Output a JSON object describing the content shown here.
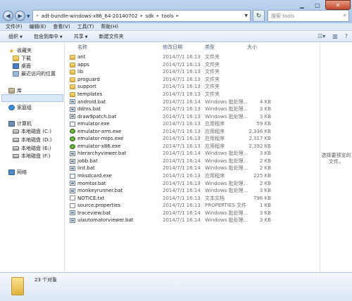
{
  "address": {
    "crumbs": [
      "adt-bundle-windows-x86_64-20140702",
      "sdk",
      "tools"
    ]
  },
  "search": {
    "placeholder": "搜索 tools"
  },
  "menubar": {
    "items": [
      "文件(F)",
      "编辑(E)",
      "查看(V)",
      "工具(T)",
      "帮助(H)"
    ]
  },
  "toolbar": {
    "organize": "组织",
    "include_in_library": "包含到库中",
    "share": "共享",
    "new_folder": "新建文件夹"
  },
  "navpane": {
    "favorites": "收藏夹",
    "downloads": "下载",
    "desktop": "桌面",
    "recent": "最近访问的位置",
    "libraries": "库",
    "homegroup": "家庭组",
    "computer": "计算机",
    "drive_c": "本地磁盘 (C:)",
    "drive_d": "本地磁盘 (D:)",
    "drive_e": "本地磁盘 (E:)",
    "drive_f": "本地磁盘 (F:)",
    "network": "网络"
  },
  "columns": {
    "name": "名称",
    "date": "修改日期",
    "type": "类型",
    "size": "大小"
  },
  "files": [
    {
      "name": "ant",
      "date": "2014/7/1 16:13",
      "type": "文件夹",
      "size": "",
      "icon": "folder"
    },
    {
      "name": "apps",
      "date": "2014/7/1 16:13",
      "type": "文件夹",
      "size": "",
      "icon": "folder"
    },
    {
      "name": "lib",
      "date": "2014/7/1 16:13",
      "type": "文件夹",
      "size": "",
      "icon": "folder"
    },
    {
      "name": "proguard",
      "date": "2014/7/1 16:13",
      "type": "文件夹",
      "size": "",
      "icon": "folder"
    },
    {
      "name": "support",
      "date": "2014/7/1 16:13",
      "type": "文件夹",
      "size": "",
      "icon": "folder"
    },
    {
      "name": "templates",
      "date": "2014/7/1 16:13",
      "type": "文件夹",
      "size": "",
      "icon": "folder"
    },
    {
      "name": "android.bat",
      "date": "2014/7/1 16:14",
      "type": "Windows 批处理...",
      "size": "4 KB",
      "icon": "bat"
    },
    {
      "name": "ddms.bat",
      "date": "2014/7/1 16:13",
      "type": "Windows 批处理...",
      "size": "3 KB",
      "icon": "bat"
    },
    {
      "name": "draw9patch.bat",
      "date": "2014/7/1 16:13",
      "type": "Windows 批处理...",
      "size": "3 KB",
      "icon": "bat"
    },
    {
      "name": "emulator.exe",
      "date": "2014/7/1 16:13",
      "type": "应用程序",
      "size": "59 KB",
      "icon": "exe"
    },
    {
      "name": "emulator-arm.exe",
      "date": "2014/7/1 16:13",
      "type": "应用程序",
      "size": "2,336 KB",
      "icon": "emu"
    },
    {
      "name": "emulator-mips.exe",
      "date": "2014/7/1 16:13",
      "type": "应用程序",
      "size": "2,317 KB",
      "icon": "emu"
    },
    {
      "name": "emulator-x86.exe",
      "date": "2014/7/1 16:13",
      "type": "应用程序",
      "size": "2,392 KB",
      "icon": "emu"
    },
    {
      "name": "hierarchyviewer.bat",
      "date": "2014/7/1 16:14",
      "type": "Windows 批处理...",
      "size": "3 KB",
      "icon": "bat"
    },
    {
      "name": "jobb.bat",
      "date": "2014/7/1 16:14",
      "type": "Windows 批处理...",
      "size": "2 KB",
      "icon": "bat"
    },
    {
      "name": "lint.bat",
      "date": "2014/7/1 16:14",
      "type": "Windows 批处理...",
      "size": "2 KB",
      "icon": "bat"
    },
    {
      "name": "mksdcard.exe",
      "date": "2014/7/1 16:13",
      "type": "应用程序",
      "size": "225 KB",
      "icon": "exe"
    },
    {
      "name": "monitor.bat",
      "date": "2014/7/1 16:13",
      "type": "Windows 批处理...",
      "size": "2 KB",
      "icon": "bat"
    },
    {
      "name": "monkeyrunner.bat",
      "date": "2014/7/1 16:14",
      "type": "Windows 批处理...",
      "size": "3 KB",
      "icon": "bat"
    },
    {
      "name": "NOTICE.txt",
      "date": "2014/7/1 16:13",
      "type": "文本文档",
      "size": "796 KB",
      "icon": "txt"
    },
    {
      "name": "source.properties",
      "date": "2014/7/1 16:13",
      "type": "PROPERTIES 文件",
      "size": "1 KB",
      "icon": "prop"
    },
    {
      "name": "traceview.bat",
      "date": "2014/7/1 16:14",
      "type": "Windows 批处理...",
      "size": "3 KB",
      "icon": "bat"
    },
    {
      "name": "uiautomatorviewer.bat",
      "date": "2014/7/1 16:14",
      "type": "Windows 批处理...",
      "size": "3 KB",
      "icon": "bat"
    }
  ],
  "preview": {
    "text": "选择要预览的文件。"
  },
  "details": {
    "count": "23 个对象"
  }
}
